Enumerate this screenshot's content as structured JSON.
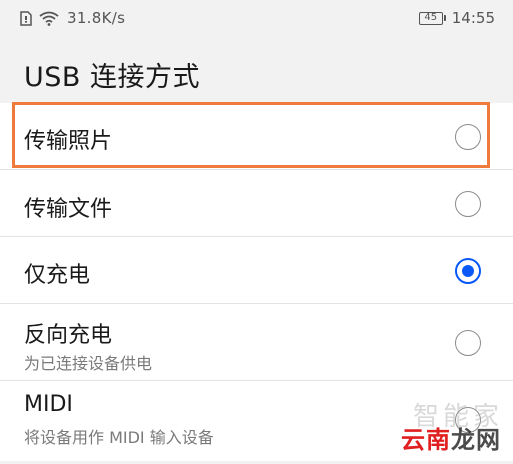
{
  "status_bar": {
    "left_icons": [
      "sim-card-icon",
      "wifi-icon"
    ],
    "speed": "31.8K/s",
    "battery": "45",
    "time": "14:55"
  },
  "header": {
    "title": "USB 连接方式"
  },
  "options": [
    {
      "title": "传输照片",
      "subtitle": "",
      "selected": false,
      "highlighted": true
    },
    {
      "title": "传输文件",
      "subtitle": "",
      "selected": false,
      "highlighted": false
    },
    {
      "title": "仅充电",
      "subtitle": "",
      "selected": true,
      "highlighted": false
    },
    {
      "title": "反向充电",
      "subtitle": "为已连接设备供电",
      "selected": false,
      "highlighted": false
    },
    {
      "title": "MIDI",
      "subtitle": "将设备用作 MIDI 输入设备",
      "selected": false,
      "highlighted": false
    }
  ],
  "watermark": {
    "top": "智能家",
    "bottom_red": "云南",
    "bottom_dark": "龙网"
  },
  "colors": {
    "accent": "#0a59f7",
    "highlight": "#f07a3c"
  }
}
